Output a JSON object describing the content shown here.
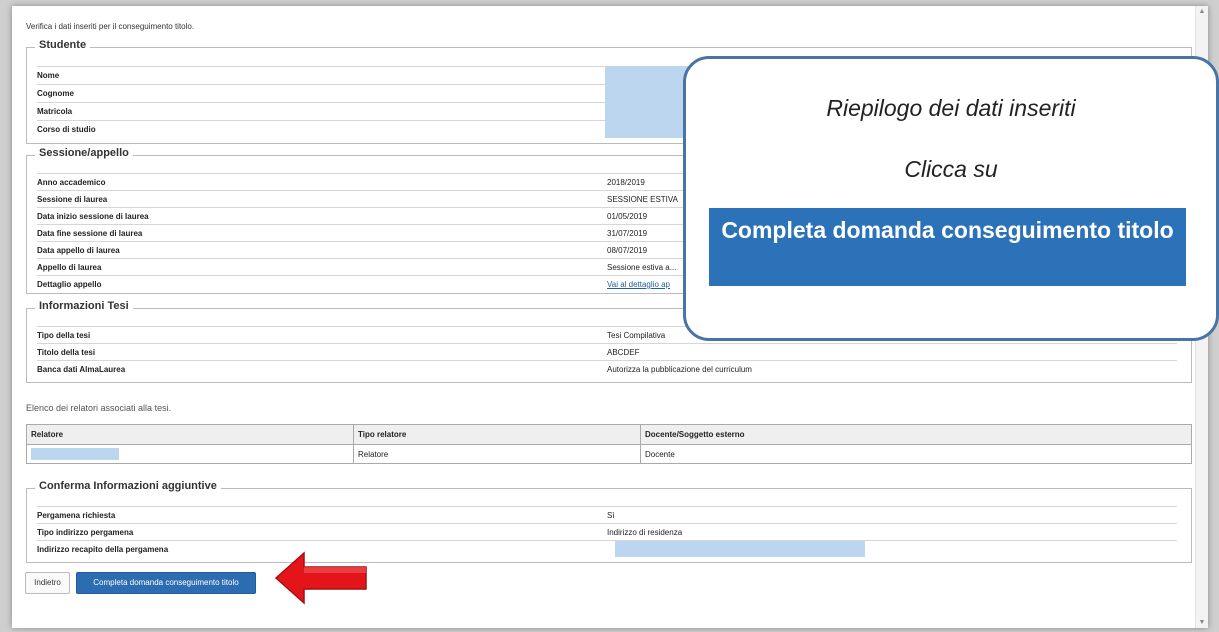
{
  "intro": "Verifica i dati inseriti per il conseguimento titolo.",
  "studente": {
    "title": "Studente",
    "rows": [
      {
        "label": "Nome",
        "value": ""
      },
      {
        "label": "Cognome",
        "value": ""
      },
      {
        "label": "Matricola",
        "value": ""
      },
      {
        "label": "Corso di studio",
        "value": ""
      }
    ]
  },
  "sessione": {
    "title": "Sessione/appello",
    "rows": [
      {
        "label": "Anno accademico",
        "value": "2018/2019"
      },
      {
        "label": "Sessione di laurea",
        "value": "SESSIONE ESTIVA"
      },
      {
        "label": "Data inizio sessione di laurea",
        "value": "01/05/2019"
      },
      {
        "label": "Data fine sessione di laurea",
        "value": "31/07/2019"
      },
      {
        "label": "Data appello di laurea",
        "value": "08/07/2019"
      },
      {
        "label": "Appello di laurea",
        "value": "Sessione estiva a..."
      },
      {
        "label": "Dettaglio appello",
        "value": "Vai al dettaglio ap"
      }
    ]
  },
  "tesi": {
    "title": "Informazioni Tesi",
    "rows": [
      {
        "label": "Tipo della tesi",
        "value": "Tesi Compilativa"
      },
      {
        "label": "Titolo della tesi",
        "value": "ABCDEF"
      },
      {
        "label": "Banca dati AlmaLaurea",
        "value": "Autorizza la pubblicazione del curriculum"
      }
    ]
  },
  "relatori": {
    "note": "Elenco dei relatori associati alla tesi.",
    "headers": [
      "Relatore",
      "Tipo relatore",
      "Docente/Soggetto esterno"
    ],
    "rows": [
      {
        "relatore": "",
        "tipo": "Relatore",
        "docente": "Docente"
      }
    ]
  },
  "conferma": {
    "title": "Conferma Informazioni aggiuntive",
    "rows": [
      {
        "label": "Pergamena richiesta",
        "value": "Sì"
      },
      {
        "label": "Tipo indirizzo pergamena",
        "value": "Indirizzo di residenza"
      },
      {
        "label": "Indirizzo recapito della pergamena",
        "value": ""
      }
    ]
  },
  "buttons": {
    "back": "Indietro",
    "submit": "Completa domanda conseguimento titolo"
  },
  "callout": {
    "line1": "Riepilogo dei dati inseriti",
    "line2": "Clicca su",
    "highlight": "Completa domanda conseguimento titolo"
  },
  "colors": {
    "primary_button": "#2c6db1",
    "callout_border": "#4a74a8",
    "arrow": "#e3151a",
    "redaction": "#bcd6ef"
  }
}
